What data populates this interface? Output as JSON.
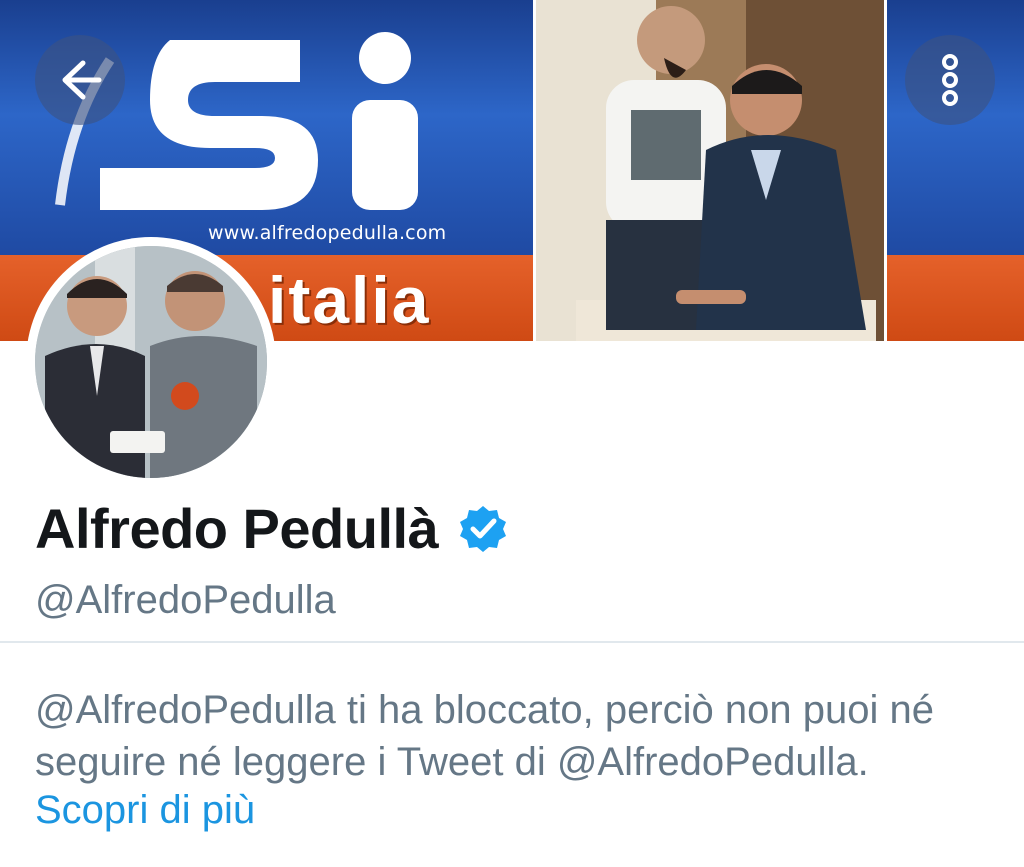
{
  "banner": {
    "url_text": "www.alfredopedulla.com",
    "wordmark": "italia"
  },
  "header": {
    "back_icon": "arrow-left-icon",
    "more_icon": "more-vertical-icon"
  },
  "profile": {
    "display_name": "Alfredo Pedullà",
    "verified_icon": "verified-badge-icon",
    "verified_color": "#1da1f2",
    "handle": "@AlfredoPedulla"
  },
  "blocked": {
    "message": "@AlfredoPedulla ti ha bloccato, perciò non puoi né seguire né leggere i Tweet di @AlfredoPedulla.",
    "learn_more": "Scopri di più"
  },
  "colors": {
    "banner_blue": "#2d66c8",
    "banner_orange": "#e5612a",
    "link": "#1b95e0",
    "secondary_text": "#657786"
  }
}
